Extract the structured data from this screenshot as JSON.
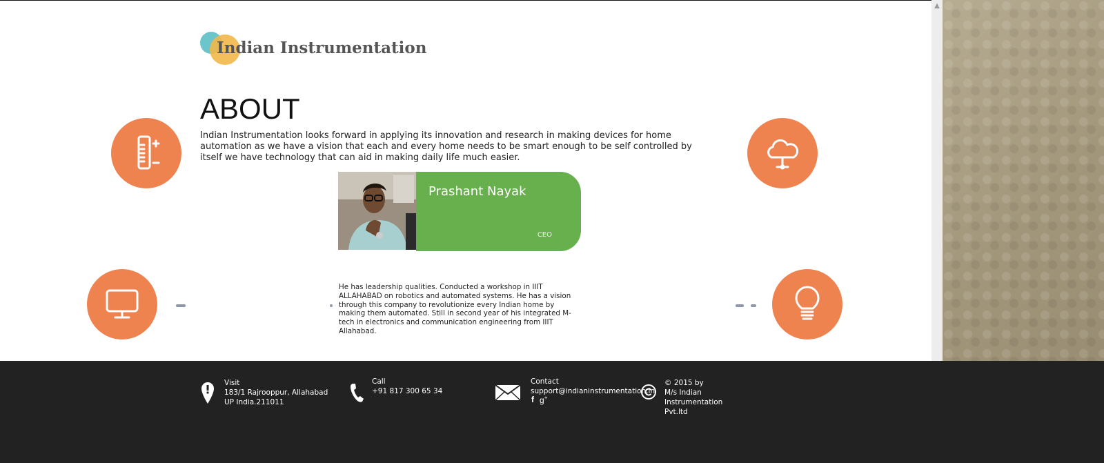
{
  "header": {
    "logo_text": "Indian Instrumentation"
  },
  "about": {
    "title": "ABOUT",
    "text": "Indian Instrumentation looks forward in applying its innovation and research in making devices for home automation as we have a vision that each and every home needs to be smart enough to be self controlled by itself we have technology that can aid in making daily life much easier."
  },
  "features": [
    {
      "icon": "thermometer-icon"
    },
    {
      "icon": "cloud-icon"
    },
    {
      "icon": "monitor-icon"
    },
    {
      "icon": "lightbulb-icon"
    }
  ],
  "team": {
    "name": "Prashant Nayak",
    "role": "CEO",
    "bio": "He has leadership qualities. Conducted a workshop in IIIT ALLAHABAD on robotics and automated systems. He has a vision through this company to revolutionize every Indian home by making them automated. Still in second year of his integrated M-tech in electronics and communication engineering from IIIT Allahabad."
  },
  "footer": {
    "visit_label": "Visit",
    "visit_line1": "183/1 Rajrooppur, Allahabad",
    "visit_line2": "UP India.211011",
    "call_label": "Call",
    "call_number": "+91 817 300 65 34",
    "contact_label": "Contact",
    "contact_email": "support@indianinstrumentation.in",
    "copy_line1": "© 2015 by",
    "copy_line2": "M/s Indian",
    "copy_line3": "Instrumentation",
    "copy_line4": "Pvt.ltd"
  },
  "colors": {
    "accent_orange": "#ee8350",
    "card_green": "#68b04e",
    "footer_bg": "#222222"
  }
}
